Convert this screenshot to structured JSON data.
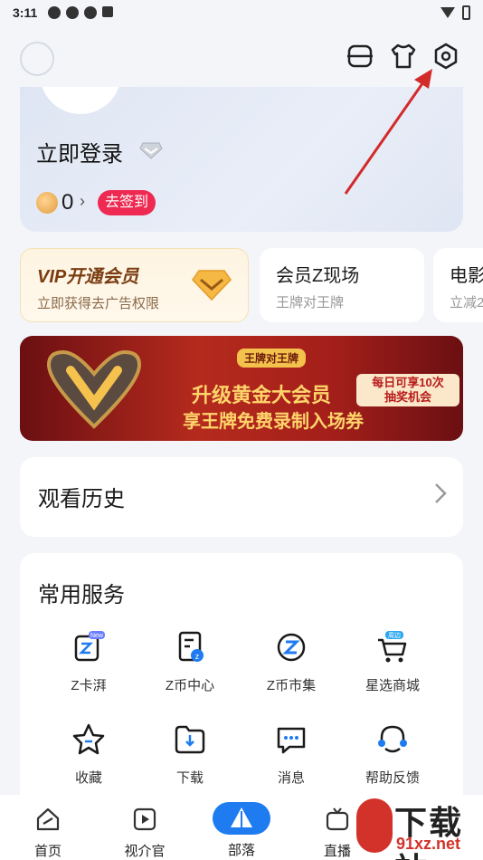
{
  "status": {
    "time": "3:11"
  },
  "profile": {
    "login": "立即登录",
    "coins": "0",
    "sign_in": "去签到"
  },
  "vip_cards": [
    {
      "title": "VIP开通会员",
      "sub": "立即获得去广告权限"
    },
    {
      "title": "会员Z现场",
      "sub": "王牌对王牌"
    },
    {
      "title": "电影",
      "sub": "立减2"
    }
  ],
  "banner": {
    "badge": "王牌对王牌",
    "line1": "升级黄金大会员",
    "line2": "享王牌免费录制入场券",
    "tag1": "每日可享10次",
    "tag2": "抽奖机会"
  },
  "history": {
    "title": "观看历史"
  },
  "services": {
    "title": "常用服务",
    "items": [
      {
        "label": "Z卡湃",
        "icon": "z-card-icon",
        "badge": "New"
      },
      {
        "label": "Z币中心",
        "icon": "z-coin-center-icon"
      },
      {
        "label": "Z币市集",
        "icon": "z-coin-market-icon"
      },
      {
        "label": "星选商城",
        "icon": "cart-icon",
        "badge": "周边"
      },
      {
        "label": "收藏",
        "icon": "star-icon"
      },
      {
        "label": "下载",
        "icon": "download-folder-icon"
      },
      {
        "label": "消息",
        "icon": "message-icon"
      },
      {
        "label": "帮助反馈",
        "icon": "help-feedback-icon"
      }
    ]
  },
  "tabs": [
    {
      "label": "首页",
      "icon": "home-icon"
    },
    {
      "label": "视介官",
      "icon": "video-icon"
    },
    {
      "label": "部落",
      "icon": "tribe-icon"
    },
    {
      "label": "直播",
      "icon": "live-icon"
    }
  ],
  "watermark": {
    "big": "下载站",
    "small": "91xz.net"
  },
  "colors": {
    "accent": "#1e7bf0",
    "sign_in": "#ee2a52",
    "vip_gold": "#7a3c10",
    "arrow": "#d32a2a"
  }
}
